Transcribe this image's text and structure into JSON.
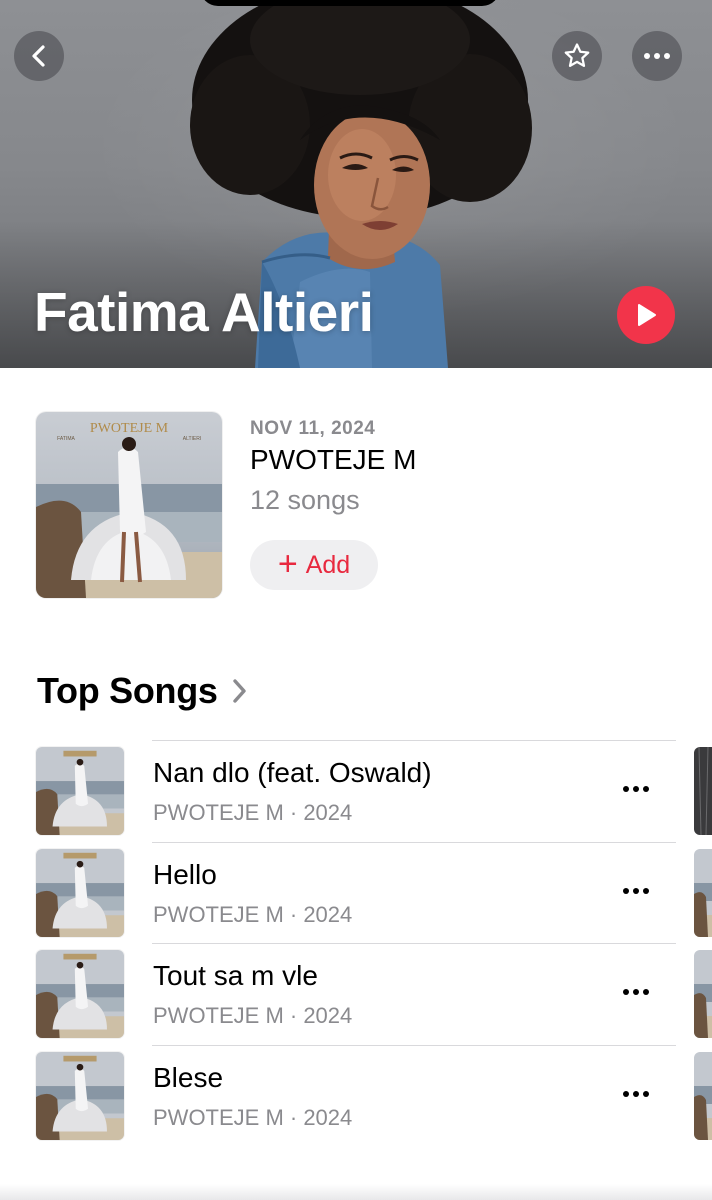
{
  "artist": {
    "name": "Fatima Altieri"
  },
  "hero": {
    "back_icon": "chevron-left-icon",
    "favorite_icon": "star-outline-icon",
    "more_icon": "ellipsis-icon",
    "play_icon": "play-icon"
  },
  "latest_release": {
    "date": "NOV 11, 2024",
    "title": "PWOTEJE M",
    "song_count": "12 songs",
    "add_label": "Add",
    "cover_text_title": "PWOTEJE M",
    "cover_text_left": "FATIMA",
    "cover_text_right": "ALTIERI"
  },
  "top_songs": {
    "header": "Top Songs",
    "songs": [
      {
        "title": "Nan dlo (feat. Oswald)",
        "subtitle": "PWOTEJE M · 2024"
      },
      {
        "title": "Hello",
        "subtitle": "PWOTEJE M · 2024"
      },
      {
        "title": "Tout sa m vle",
        "subtitle": "PWOTEJE M · 2024"
      },
      {
        "title": "Blese",
        "subtitle": "PWOTEJE M · 2024"
      }
    ]
  },
  "colors": {
    "accent": "#f2344a",
    "add_text": "#e8293f",
    "secondary_text": "#8a8a8e"
  }
}
